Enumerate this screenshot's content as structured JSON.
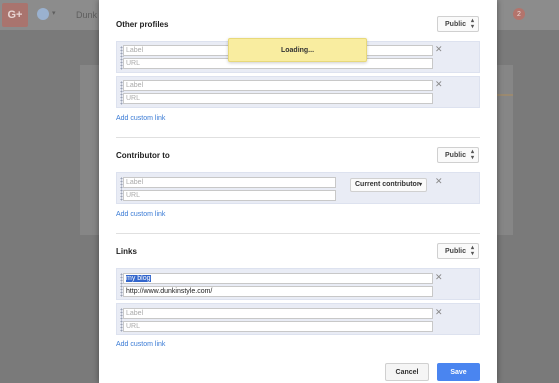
{
  "background": {
    "logo": "G+",
    "name": "Dunk",
    "notification_count": "2"
  },
  "other_profiles": {
    "title": "Other profiles",
    "visibility": "Public",
    "entries": [
      {
        "label_placeholder": "Label",
        "url_placeholder": "URL"
      },
      {
        "label_placeholder": "Label",
        "url_placeholder": "URL"
      }
    ],
    "add_link": "Add custom link"
  },
  "contributor": {
    "title": "Contributor to",
    "visibility": "Public",
    "entries": [
      {
        "label_placeholder": "Label",
        "url_placeholder": "URL",
        "dropdown": "Current contributor"
      }
    ],
    "add_link": "Add custom link"
  },
  "links": {
    "title": "Links",
    "visibility": "Public",
    "entries": [
      {
        "label_value": "my blog",
        "url_value": "http://www.dunkinstyle.com/"
      },
      {
        "label_placeholder": "Label",
        "url_placeholder": "URL"
      }
    ],
    "add_link": "Add custom link"
  },
  "loading_message": "Loading...",
  "footer": {
    "cancel_label": "Cancel",
    "save_label": "Save"
  },
  "icons": {
    "remove": "close-icon",
    "drag": "drag-handle-icon",
    "visibility_toggle": "up-down-chevron-icon"
  },
  "colors": {
    "accent": "#4a85f0",
    "link": "#3a7bd5",
    "entry_bg": "#e9ecf5",
    "loading_bg": "#f9eda0"
  }
}
